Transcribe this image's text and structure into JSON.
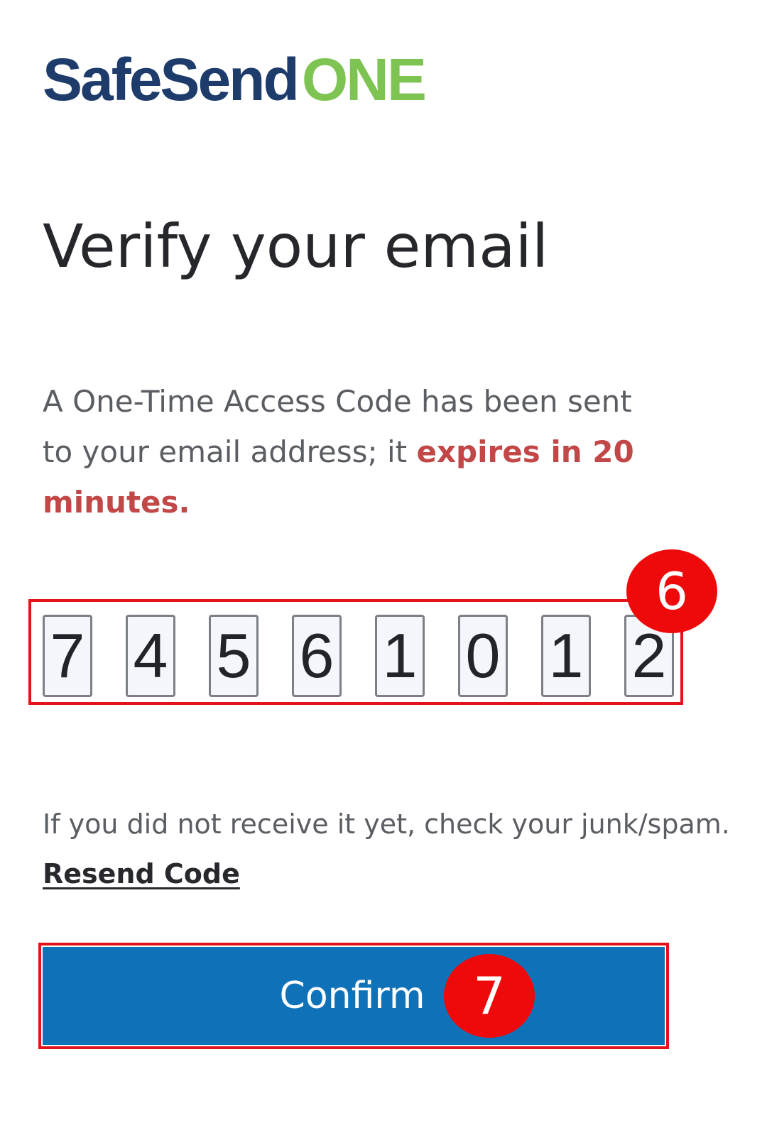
{
  "brand": {
    "name_part1": "SafeSend",
    "name_part2": "ONE",
    "primary_color": "#1d3b6b",
    "accent_color": "#7ec452"
  },
  "page": {
    "title": "Verify your email",
    "description_prefix": "A One-Time Access Code has been sent to your email address; it ",
    "description_highlight": "expires in 20 minutes.",
    "highlight_color": "#c24747"
  },
  "code": {
    "digits": [
      "7",
      "4",
      "5",
      "6",
      "1",
      "0",
      "1",
      "2"
    ]
  },
  "annotations": {
    "code_step": "6",
    "confirm_step": "7",
    "color": "#ee0a0a"
  },
  "help": {
    "hint": "If you did not receive it yet, check your junk/spam.",
    "resend_label": "Resend Code"
  },
  "actions": {
    "confirm_label": "Confirm",
    "button_color": "#0f72b8"
  }
}
